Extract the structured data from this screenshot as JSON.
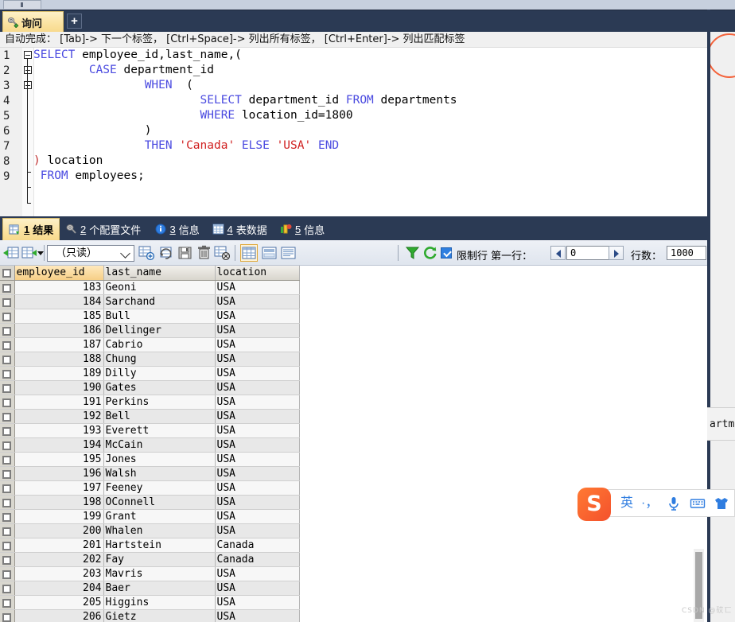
{
  "window": {
    "mini_tab": ""
  },
  "query_tabs": {
    "active_label": "询问",
    "add_label": "+",
    "icon": "key-icon"
  },
  "hint": {
    "text": "自动完成： [Tab]-> 下一个标签， [Ctrl+Space]-> 列出所有标签， [Ctrl+Enter]-> 列出匹配标签"
  },
  "editor": {
    "line_numbers": [
      "1",
      "2",
      "3",
      "4",
      "5",
      "6",
      "7",
      "8",
      "9"
    ],
    "lines": [
      [
        {
          "t": "SELECT",
          "c": "kw"
        },
        {
          "t": " employee_id,last_name,(",
          "c": ""
        }
      ],
      [
        {
          "t": "        ",
          "c": ""
        },
        {
          "t": "CASE",
          "c": "kw"
        },
        {
          "t": " department_id",
          "c": ""
        }
      ],
      [
        {
          "t": "                ",
          "c": ""
        },
        {
          "t": "WHEN",
          "c": "kw"
        },
        {
          "t": "  (",
          "c": ""
        }
      ],
      [
        {
          "t": "                        ",
          "c": ""
        },
        {
          "t": "SELECT",
          "c": "kw"
        },
        {
          "t": " department_id ",
          "c": ""
        },
        {
          "t": "FROM",
          "c": "kw"
        },
        {
          "t": " departments",
          "c": ""
        }
      ],
      [
        {
          "t": "                        ",
          "c": ""
        },
        {
          "t": "WHERE",
          "c": "kw"
        },
        {
          "t": " location_id=1800",
          "c": ""
        }
      ],
      [
        {
          "t": "                ",
          "c": ""
        },
        {
          "t": ")",
          "c": ""
        }
      ],
      [
        {
          "t": "                ",
          "c": ""
        },
        {
          "t": "THEN",
          "c": "kw"
        },
        {
          "t": " ",
          "c": ""
        },
        {
          "t": "'Canada'",
          "c": "str"
        },
        {
          "t": " ",
          "c": ""
        },
        {
          "t": "ELSE",
          "c": "kw"
        },
        {
          "t": " ",
          "c": ""
        },
        {
          "t": "'USA'",
          "c": "str"
        },
        {
          "t": " ",
          "c": ""
        },
        {
          "t": "END",
          "c": "kw"
        }
      ],
      [
        {
          "t": ")",
          "c": "pn"
        },
        {
          "t": " location",
          "c": ""
        }
      ],
      [
        {
          "t": " ",
          "c": ""
        },
        {
          "t": "FROM",
          "c": "kw"
        },
        {
          "t": " employees;",
          "c": ""
        }
      ]
    ]
  },
  "result_tabs": [
    {
      "num": "1",
      "label": "结果",
      "icon": "grid-result-icon",
      "active": true
    },
    {
      "num": "2",
      "label": "个配置文件",
      "icon": "profile-icon",
      "active": false
    },
    {
      "num": "3",
      "label": "信息",
      "icon": "info-icon",
      "active": false
    },
    {
      "num": "4",
      "label": "表数据",
      "icon": "table-data-icon",
      "active": false
    },
    {
      "num": "5",
      "label": "信息",
      "icon": "chart-info-icon",
      "active": false
    }
  ],
  "toolbar": {
    "mode_value": "（只读）",
    "limit_label": "限制行 第一行：",
    "first_row_value": "0",
    "rows_label": "行数：",
    "rows_value": "1000",
    "icons": [
      "import-grid-icon",
      "export-grid-icon",
      "dropdown-arrow-icon",
      "add-record-icon",
      "refresh-record-icon",
      "save-record-icon",
      "delete-record-icon",
      "cancel-record-icon",
      "grid-view-icon",
      "form-view-icon",
      "text-view-icon",
      "filter-icon",
      "reload-icon"
    ]
  },
  "grid": {
    "columns": [
      "employee_id",
      "last_name",
      "location"
    ],
    "rows": [
      {
        "employee_id": "183",
        "last_name": "Geoni",
        "location": "USA"
      },
      {
        "employee_id": "184",
        "last_name": "Sarchand",
        "location": "USA"
      },
      {
        "employee_id": "185",
        "last_name": "Bull",
        "location": "USA"
      },
      {
        "employee_id": "186",
        "last_name": "Dellinger",
        "location": "USA"
      },
      {
        "employee_id": "187",
        "last_name": "Cabrio",
        "location": "USA"
      },
      {
        "employee_id": "188",
        "last_name": "Chung",
        "location": "USA"
      },
      {
        "employee_id": "189",
        "last_name": "Dilly",
        "location": "USA"
      },
      {
        "employee_id": "190",
        "last_name": "Gates",
        "location": "USA"
      },
      {
        "employee_id": "191",
        "last_name": "Perkins",
        "location": "USA"
      },
      {
        "employee_id": "192",
        "last_name": "Bell",
        "location": "USA"
      },
      {
        "employee_id": "193",
        "last_name": "Everett",
        "location": "USA"
      },
      {
        "employee_id": "194",
        "last_name": "McCain",
        "location": "USA"
      },
      {
        "employee_id": "195",
        "last_name": "Jones",
        "location": "USA"
      },
      {
        "employee_id": "196",
        "last_name": "Walsh",
        "location": "USA"
      },
      {
        "employee_id": "197",
        "last_name": "Feeney",
        "location": "USA"
      },
      {
        "employee_id": "198",
        "last_name": "OConnell",
        "location": "USA"
      },
      {
        "employee_id": "199",
        "last_name": "Grant",
        "location": "USA"
      },
      {
        "employee_id": "200",
        "last_name": "Whalen",
        "location": "USA"
      },
      {
        "employee_id": "201",
        "last_name": "Hartstein",
        "location": "Canada"
      },
      {
        "employee_id": "202",
        "last_name": "Fay",
        "location": "Canada"
      },
      {
        "employee_id": "203",
        "last_name": "Mavris",
        "location": "USA"
      },
      {
        "employee_id": "204",
        "last_name": "Baer",
        "location": "USA"
      },
      {
        "employee_id": "205",
        "last_name": "Higgins",
        "location": "USA"
      },
      {
        "employee_id": "206",
        "last_name": "Gietz",
        "location": "USA"
      }
    ]
  },
  "overlay": {
    "tooltip_fragment": "artm"
  },
  "ime": {
    "logo": "S",
    "mode": "英",
    "punct": "·，",
    "icons": [
      "mic-icon",
      "keyboard-icon",
      "skin-icon"
    ]
  },
  "watermark": "CSDN @砹匸",
  "colors": {
    "tabbar": "#2b3a54",
    "active_tab": "#fbe3a2",
    "keyword": "#4a4ae0",
    "string": "#d02020",
    "accent_checkbox": "#2f7fe0",
    "header_highlight": "#f6cf86",
    "ime_orange": "#f4512c"
  }
}
